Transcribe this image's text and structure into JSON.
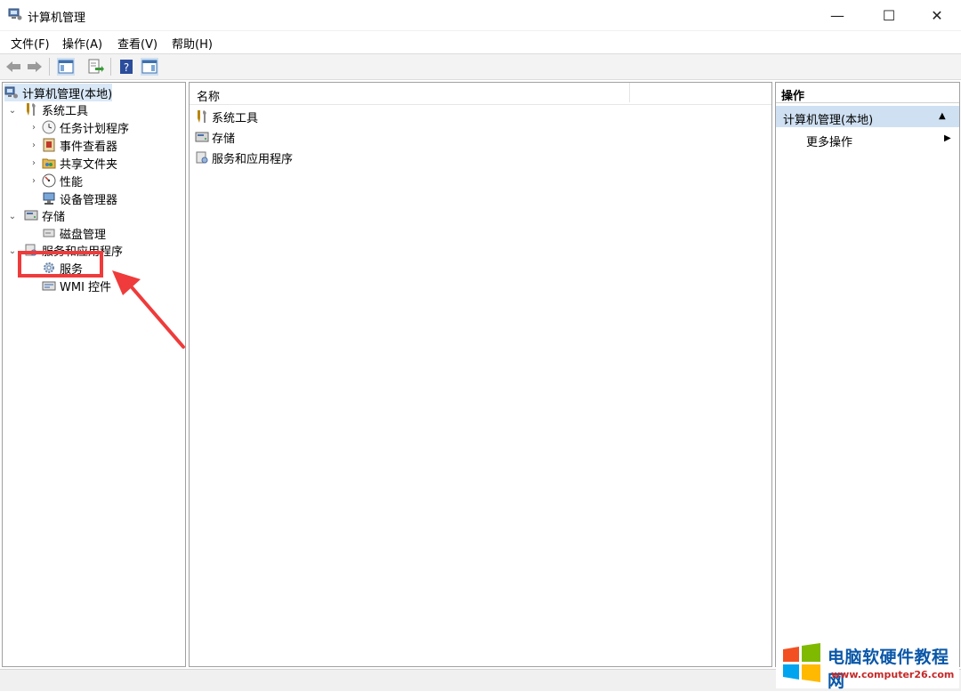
{
  "window": {
    "title": "计算机管理",
    "controls": {
      "minimize": "—",
      "maximize": "☐",
      "close": "✕"
    }
  },
  "menu": {
    "file": "文件(F)",
    "action": "操作(A)",
    "view": "查看(V)",
    "help": "帮助(H)"
  },
  "tree": {
    "root": "计算机管理(本地)",
    "system_tools": "系统工具",
    "task_scheduler": "任务计划程序",
    "event_viewer": "事件查看器",
    "shared_folders": "共享文件夹",
    "performance": "性能",
    "device_manager": "设备管理器",
    "storage": "存储",
    "disk_management": "磁盘管理",
    "services_apps": "服务和应用程序",
    "services": "服务",
    "wmi": "WMI 控件"
  },
  "list": {
    "column_name": "名称",
    "items": [
      "系统工具",
      "存储",
      "服务和应用程序"
    ]
  },
  "actions": {
    "header": "操作",
    "section": "计算机管理(本地)",
    "more": "更多操作"
  },
  "watermark": {
    "title": "电脑软硬件教程网",
    "url": "www.computer26.com"
  },
  "colors": {
    "highlight": "#ef3b3b",
    "selection": "#cfe0f2",
    "watermark_blue": "#0a57a8",
    "watermark_red": "#c62828"
  }
}
